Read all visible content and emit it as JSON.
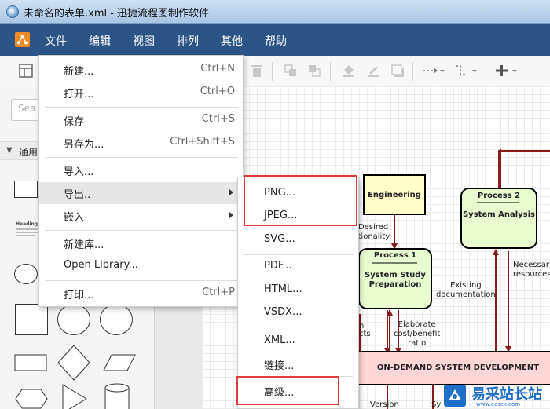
{
  "window": {
    "title": "未命名的表单.xml - 迅捷流程图制作软件"
  },
  "menubar": {
    "items": [
      {
        "id": "file",
        "label": "文件"
      },
      {
        "id": "edit",
        "label": "编辑"
      },
      {
        "id": "view",
        "label": "视图"
      },
      {
        "id": "arrange",
        "label": "排列"
      },
      {
        "id": "other",
        "label": "其他"
      },
      {
        "id": "help",
        "label": "帮助"
      }
    ]
  },
  "left_panel": {
    "search_placeholder": "Sea",
    "section_label": "通用",
    "heading_thumb_label": "Heading"
  },
  "file_menu": {
    "new": {
      "label": "新建...",
      "shortcut": "Ctrl+N"
    },
    "open": {
      "label": "打开...",
      "shortcut": "Ctrl+O"
    },
    "save": {
      "label": "保存",
      "shortcut": "Ctrl+S"
    },
    "save_as": {
      "label": "另存为...",
      "shortcut": "Ctrl+Shift+S"
    },
    "import": {
      "label": "导入..."
    },
    "export": {
      "label": "导出.."
    },
    "embed": {
      "label": "嵌入"
    },
    "new_library": {
      "label": "新建库..."
    },
    "open_library": {
      "label": "Open Library..."
    },
    "print": {
      "label": "打印...",
      "shortcut": "Ctrl+P"
    }
  },
  "export_submenu": {
    "png": "PNG...",
    "jpeg": "JPEG...",
    "svg": "SVG...",
    "pdf": "PDF...",
    "html": "HTML...",
    "vsdx": "VSDX...",
    "xml": "XML...",
    "link": "链接...",
    "advanced": "高级..."
  },
  "diagram": {
    "engineering": "Engineering",
    "process1_title": "Process 1",
    "process1_body": [
      "System Study",
      "Preparation"
    ],
    "process2_title": "Process 2",
    "process2_body": "System Analysis",
    "ondemand": "ON-DEMAND SYSTEM DEVELOPMENT",
    "label_desired": [
      "Desired",
      "ctionality"
    ],
    "label_existing": [
      "Existing",
      "documentation"
    ],
    "label_necessary": [
      "Necessary",
      "resources"
    ],
    "label_elaborate": [
      "Elaborate",
      "cost/benefit",
      "ratio"
    ],
    "label_n": "n",
    "label_cts": "cts",
    "label_version": "Version",
    "label_sy": "Sy"
  },
  "watermark": {
    "text": "易采站长站",
    "url": "www.easck.com"
  },
  "colors": {
    "menubar_bg": "#2b5587",
    "logo_orange": "#f08a24",
    "menu_highlight": "#e6e6e6",
    "red_highlight": "#e23a3a",
    "process_fill": "#e8fcd0",
    "engineering_fill": "#fffdc8",
    "ondemand_fill": "#ffd6d6",
    "connector": "#8b1a1a",
    "watermark_blue": "#1f6fc9"
  },
  "icons": {
    "app": "app-globe-icon",
    "logo": "app-logo-icon",
    "format_panel": "format-panel-icon",
    "delete": "trash-icon",
    "to_front": "to-front-icon",
    "to_back": "to-back-icon",
    "fill": "fill-color-icon",
    "line": "line-color-icon",
    "shadow": "shadow-icon",
    "connection": "connection-arrow-icon",
    "waypoints": "waypoint-icon",
    "insert": "insert-plus-icon"
  }
}
